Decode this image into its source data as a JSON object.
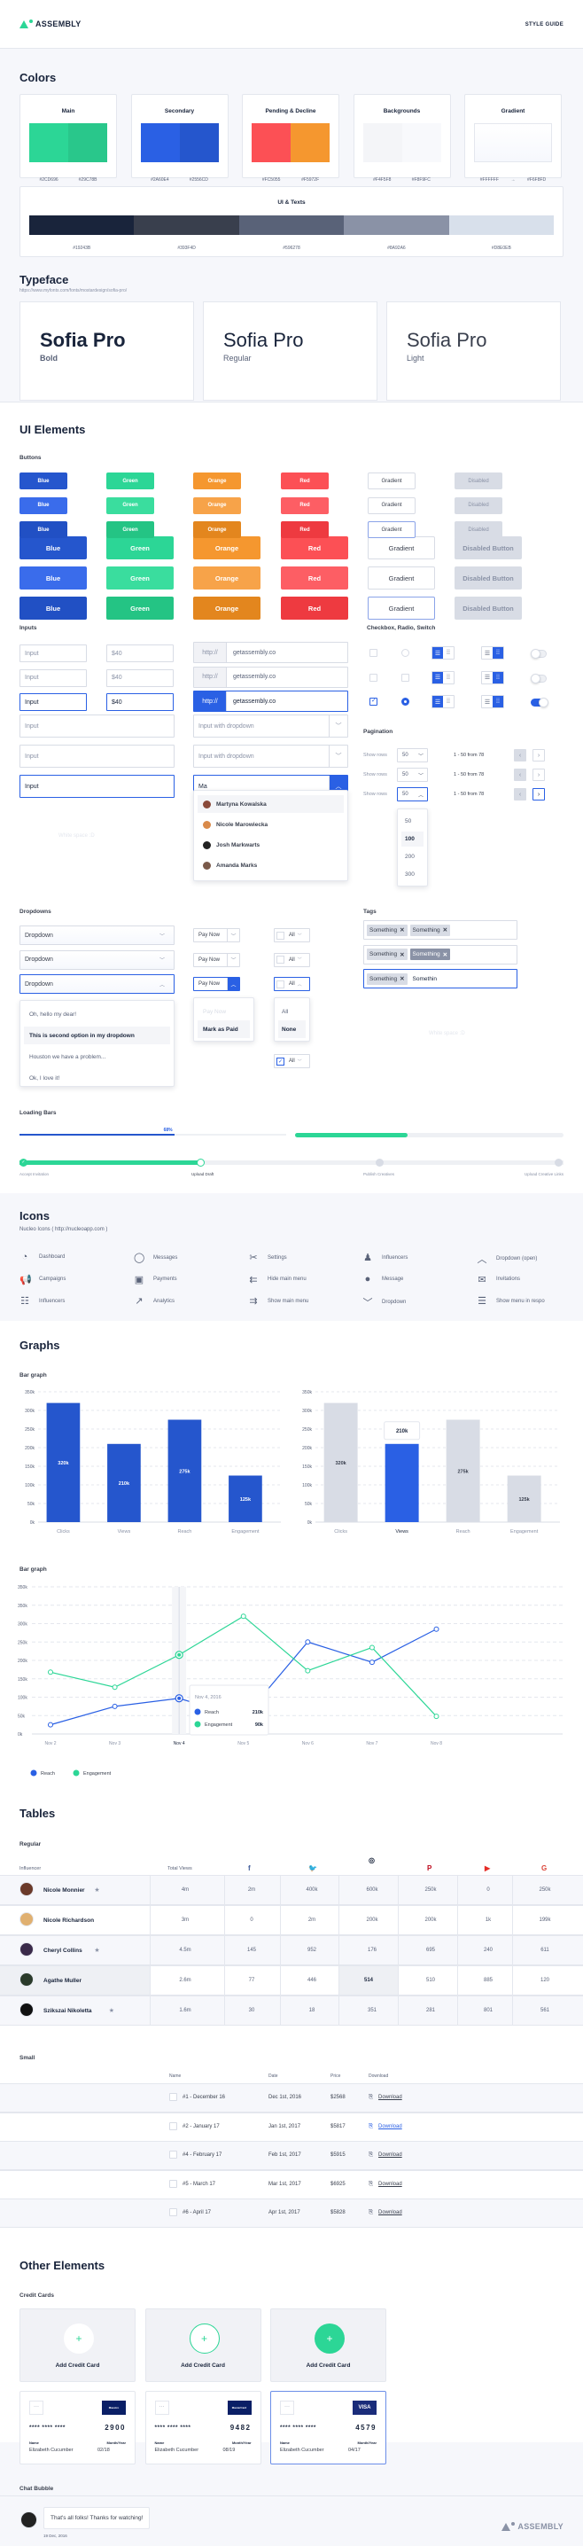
{
  "header": {
    "brand": "ASSEMBLY",
    "title": "STYLE GUIDE"
  },
  "colors": {
    "title": "Colors",
    "groups": [
      {
        "label": "Main",
        "swatches": [
          {
            "hex": "#2CD696"
          },
          {
            "hex": "#29C78B"
          }
        ]
      },
      {
        "label": "Secondary",
        "swatches": [
          {
            "hex": "#2A60E4"
          },
          {
            "hex": "#2556CD"
          }
        ]
      },
      {
        "label": "Pending & Decline",
        "swatches": [
          {
            "hex": "#FC5055"
          },
          {
            "hex": "#F5972F"
          }
        ]
      },
      {
        "label": "Backgrounds",
        "swatches": [
          {
            "hex": "#F4F5F8"
          },
          {
            "hex": "#F8F9FC"
          }
        ]
      },
      {
        "label": "Gradient",
        "from": "#FFFFFF",
        "arrow": "→",
        "to": "#F6F8FD"
      }
    ],
    "ui_texts": {
      "label": "UI & Texts",
      "swatches": [
        "#19243B",
        "#393F4D",
        "#596278",
        "#8A92A6",
        "#D8E0EB"
      ]
    }
  },
  "typeface": {
    "title": "Typeface",
    "link": "https://www.myfonts.com/fonts/mostardesign/sofia-pro/",
    "samples": [
      {
        "name": "Sofia Pro",
        "weight": "Bold"
      },
      {
        "name": "Sofia Pro",
        "weight": "Regular"
      },
      {
        "name": "Sofia Pro",
        "weight": "Light"
      }
    ]
  },
  "ui_elements": {
    "title": "UI Elements",
    "buttons": {
      "label": "Buttons",
      "small": [
        "Blue",
        "Green",
        "Orange",
        "Red",
        "Gradient",
        "Disabled"
      ],
      "large": [
        "Blue",
        "Green",
        "Orange",
        "Red",
        "Gradient",
        "Disabled Button"
      ]
    },
    "inputs": {
      "label": "Inputs",
      "input_value": "Input",
      "money_value": "$40",
      "prefix": "http://",
      "url_value": "getassembly.co",
      "dropdown_placeholder": "Input with dropdown",
      "typed_value": "Ma",
      "suggestions": [
        "Martyna Kowalska",
        "Nicole Marowiecka",
        "Josh Markwarts",
        "Amanda Marks"
      ],
      "whitespace": "White space :D"
    },
    "checks": {
      "label": "Checkbox, Radio, Switch"
    },
    "pagination": {
      "label": "Pagination",
      "show_rows": "Show rows",
      "rows_value": "50",
      "range": "1 - 50 from 78",
      "options": [
        "50",
        "100",
        "200",
        "300"
      ]
    },
    "dropdowns": {
      "label": "Dropdowns",
      "value": "Dropdown",
      "options": [
        "Oh, hello my dear!",
        "This is second option in my dropdown",
        "Houston we have a problem...",
        "Ok, I love it!"
      ],
      "split_label": "Pay Now",
      "split_options": [
        "Pay Now",
        "Mark as Paid"
      ],
      "check_label": "All",
      "check_options": [
        "All",
        "None"
      ]
    },
    "tags": {
      "label": "Tags",
      "tag": "Something",
      "typing": "Somethin",
      "whitespace": "White space :D"
    },
    "loading": {
      "label": "Loading Bars",
      "percent_label": "68%",
      "progress1": 0.58,
      "progress2": 0.42,
      "steps": [
        "Accept Invitation",
        "Upload Draft",
        "Publish Creatives",
        "Upload Creative Links"
      ],
      "current_step": 1
    }
  },
  "icons": {
    "title": "Icons",
    "source": "Nucleo Icons ( http://nucleoapp.com )",
    "items": [
      {
        "name": "Dashboard",
        "glyph": "◔"
      },
      {
        "name": "Messages",
        "glyph": "◯"
      },
      {
        "name": "Settings",
        "glyph": "✂"
      },
      {
        "name": "Influencers",
        "glyph": "♟"
      },
      {
        "name": "Dropdown (open)",
        "glyph": "︿"
      },
      {
        "name": "Campaigns",
        "glyph": "📢"
      },
      {
        "name": "Payments",
        "glyph": "▣"
      },
      {
        "name": "Hide main menu",
        "glyph": "⇇"
      },
      {
        "name": "Message",
        "glyph": "●"
      },
      {
        "name": "Invitations",
        "glyph": "✉"
      },
      {
        "name": "Influencers",
        "glyph": "☷"
      },
      {
        "name": "Analytics",
        "glyph": "↗"
      },
      {
        "name": "Show main menu",
        "glyph": "⇉"
      },
      {
        "name": "Dropdown",
        "glyph": "﹀"
      },
      {
        "name": "Show menu in respo",
        "glyph": "☰"
      }
    ]
  },
  "graphs": {
    "title": "Graphs",
    "tooltip_bar": "210k",
    "tooltip_line": {
      "date": "Nov 4, 2016",
      "reach": "210k",
      "engagement": "90k",
      "reach_label": "Reach",
      "engagement_label": "Engagement"
    }
  },
  "chart_data": [
    {
      "type": "bar",
      "title": "Bar graph",
      "categories": [
        "Clicks",
        "Views",
        "Reach",
        "Engagement"
      ],
      "values": [
        320,
        210,
        275,
        125
      ],
      "value_labels": [
        "320k",
        "210k",
        "275k",
        "125k"
      ],
      "yticks": [
        "0k",
        "50k",
        "100k",
        "150k",
        "200k",
        "250k",
        "300k",
        "350k"
      ],
      "ylim": [
        0,
        350
      ],
      "grid": true
    },
    {
      "type": "bar",
      "title": "",
      "categories": [
        "Clicks",
        "Views",
        "Reach",
        "Engagement"
      ],
      "values": [
        320,
        210,
        275,
        125
      ],
      "value_labels": [
        "320k",
        "210k",
        "275k",
        "125k"
      ],
      "yticks": [
        "0k",
        "50k",
        "100k",
        "150k",
        "200k",
        "250k",
        "300k",
        "350k"
      ],
      "ylim": [
        0,
        350
      ],
      "highlight": 1,
      "grid": true
    },
    {
      "type": "line",
      "title": "Bar graph",
      "x": [
        "Nov 2",
        "Nov 3",
        "Nov 4",
        "Nov 5",
        "Nov 6",
        "Nov 7",
        "Nov 8"
      ],
      "yticks": [
        "0k",
        "50k",
        "100k",
        "150k",
        "200k",
        "250k",
        "300k",
        "350k",
        "350k"
      ],
      "ylim": [
        0,
        400
      ],
      "series": [
        {
          "name": "Reach",
          "color": "#2A60E4",
          "values": [
            25,
            75,
            97,
            43,
            250,
            195,
            285
          ]
        },
        {
          "name": "Engagement",
          "color": "#2CD696",
          "values": [
            168,
            127,
            215,
            320,
            172,
            235,
            48
          ]
        }
      ],
      "legend": "bottom-left",
      "grid": true
    }
  ],
  "tables": {
    "title": "Tables",
    "regular": {
      "label": "Regular",
      "columns": [
        "Influencer",
        "Total Views",
        "facebook",
        "twitter",
        "instagram",
        "pinterest",
        "youtube",
        "google"
      ],
      "rows": [
        {
          "name": "Nicole Monnier",
          "star": true,
          "values": [
            "4m",
            "2m",
            "400k",
            "600k",
            "250k",
            "0",
            "250k"
          ]
        },
        {
          "name": "Nicole Richardson",
          "star": false,
          "values": [
            "3m",
            "0",
            "2m",
            "200k",
            "200k",
            "1k",
            "199k"
          ]
        },
        {
          "name": "Cheryl Collins",
          "star": true,
          "values": [
            "4.5m",
            "145",
            "952",
            "176",
            "695",
            "240",
            "611"
          ]
        },
        {
          "name": "Agathe Muller",
          "star": false,
          "values": [
            "2.6m",
            "77",
            "446",
            "514",
            "510",
            "885",
            "120"
          ]
        },
        {
          "name": "Szikszai Nikoletta",
          "star": true,
          "values": [
            "1.6m",
            "30",
            "18",
            "351",
            "281",
            "801",
            "561"
          ]
        }
      ]
    },
    "small": {
      "label": "Small",
      "columns": [
        "Name",
        "Date",
        "Price",
        "Download"
      ],
      "rows": [
        [
          "#1 - December 16",
          "Dec 1st, 2016",
          "$2568",
          "Download"
        ],
        [
          "#2 - January 17",
          "Jan 1st, 2017",
          "$5817",
          "Download"
        ],
        [
          "#4 - February 17",
          "Feb 1st, 2017",
          "$5915",
          "Download"
        ],
        [
          "#5 - March 17",
          "Mar 1st, 2017",
          "$6925",
          "Download"
        ],
        [
          "#6 - April 17",
          "Apr 1st, 2017",
          "$5828",
          "Download"
        ]
      ]
    }
  },
  "other": {
    "title": "Other Elements",
    "cc_label": "Credit Cards",
    "add_label": "Add Credit Card",
    "cards": [
      {
        "brand": "Maestro",
        "last4": "2900",
        "name": "Elizabeth Cucumber",
        "exp": "02/18"
      },
      {
        "brand": "MasterCard",
        "last4": "9482",
        "name": "Elizabeth Cucumber",
        "exp": "08/19"
      },
      {
        "brand": "VISA",
        "last4": "4579",
        "name": "Elizabeth Cucumber",
        "exp": "04/17"
      }
    ],
    "mask": "****  ****  ****",
    "name_label": "Name",
    "exp_label": "Month/Year",
    "chat_label": "Chat Bubble",
    "chat_text": "That's all folks! Thanks for watching!",
    "chat_date": "19 Dec, 2016"
  },
  "footer": {
    "brand": "ASSEMBLY"
  }
}
